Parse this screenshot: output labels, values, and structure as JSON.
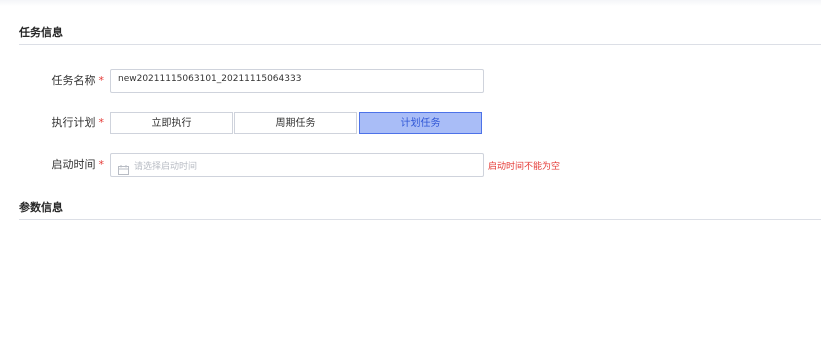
{
  "sections": {
    "task_info": "任务信息",
    "param_info": "参数信息"
  },
  "form": {
    "task_name": {
      "label": "任务名称",
      "value": "new20211115063101_20211115064333"
    },
    "schedule": {
      "label": "执行计划",
      "options": [
        "立即执行",
        "周期任务",
        "计划任务"
      ],
      "selected": "计划任务"
    },
    "start_time": {
      "label": "启动时间",
      "placeholder": "请选择启动时间",
      "error": "启动时间不能为空"
    },
    "required_mark": "*"
  },
  "colors": {
    "accent": "#4d72e8",
    "selected_bg": "#a9bdf7",
    "error": "#e53935"
  }
}
